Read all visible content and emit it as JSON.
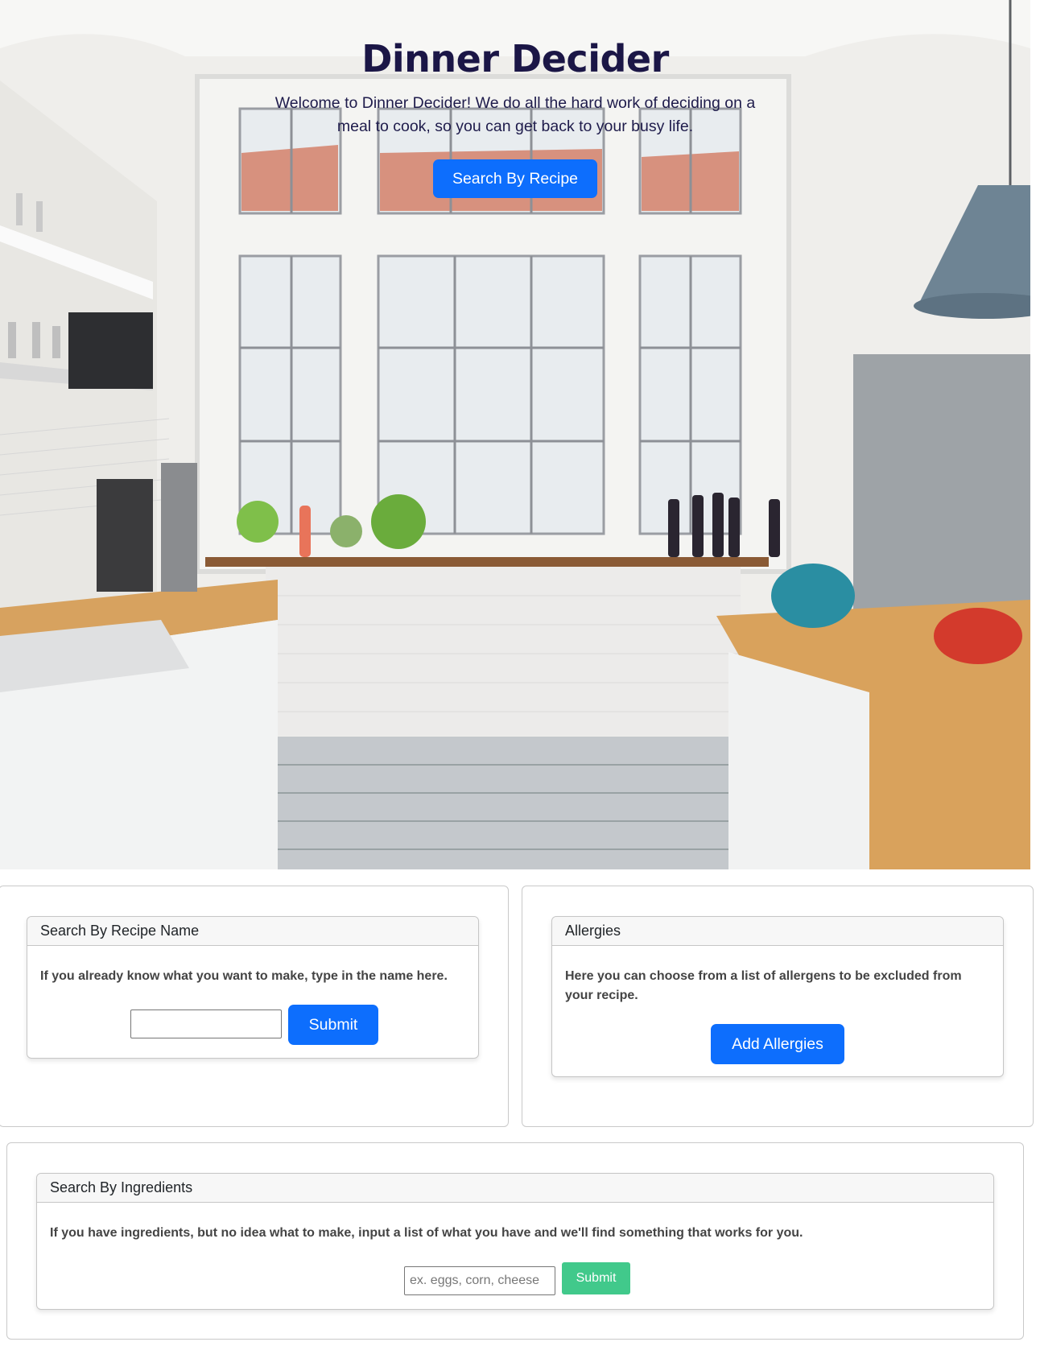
{
  "colors": {
    "primary": "#0d6efd",
    "success": "#41c98b",
    "title": "#1b1646"
  },
  "hero": {
    "title": "Dinner Decider",
    "subtitle": "Welcome to Dinner Decider! We do all the hard work of deciding on a meal to cook, so you can get back to your busy life.",
    "button_label": "Search By Recipe",
    "background_image": "kitchen-photo"
  },
  "recipe_name_card": {
    "header": "Search By Recipe Name",
    "text": "If you already know what you want to make, type in the name here.",
    "input_value": "",
    "submit_label": "Submit"
  },
  "allergies_card": {
    "header": "Allergies",
    "text": "Here you can choose from a list of allergens to be excluded from your recipe.",
    "button_label": "Add Allergies"
  },
  "ingredients_card": {
    "header": "Search By Ingredients",
    "text": "If you have ingredients, but no idea what to make, input a list of what you have and we'll find something that works for you.",
    "input_placeholder": "ex. eggs, corn, cheese",
    "submit_label": "Submit"
  }
}
